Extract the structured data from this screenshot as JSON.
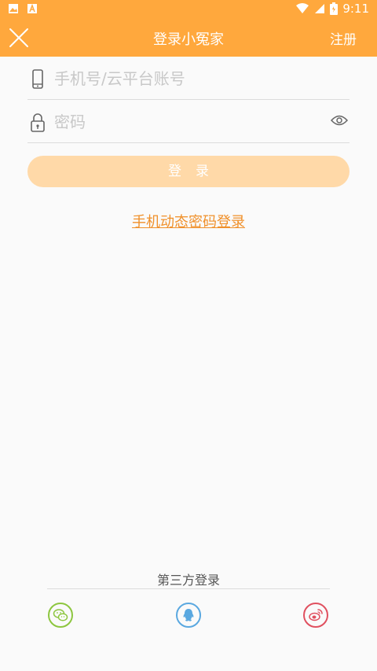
{
  "status_bar": {
    "time": "9:11"
  },
  "header": {
    "title": "登录小冤家",
    "register_label": "注册"
  },
  "form": {
    "phone_placeholder": "手机号/云平台账号",
    "password_placeholder": "密码",
    "login_label": "登录"
  },
  "sms_login_label": "手机动态密码登录",
  "third_party": {
    "label": "第三方登录",
    "providers": [
      "wechat-icon",
      "qq-icon",
      "weibo-icon"
    ]
  },
  "colors": {
    "accent": "#ffa83d",
    "button": "#ffd9a8",
    "link": "#f0902a"
  }
}
